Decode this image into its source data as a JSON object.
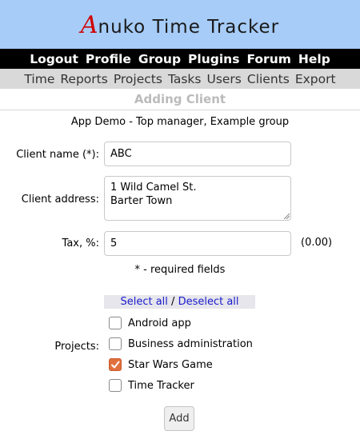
{
  "app": {
    "logo_initial": "A",
    "logo_rest": "nuko Time Tracker"
  },
  "top_menu": {
    "items": [
      "Logout",
      "Profile",
      "Group",
      "Plugins",
      "Forum",
      "Help"
    ]
  },
  "sub_menu": {
    "items": [
      "Time",
      "Reports",
      "Projects",
      "Tasks",
      "Users",
      "Clients",
      "Export"
    ]
  },
  "page": {
    "title": "Adding Client",
    "context": "App Demo - Top manager, Example group"
  },
  "form": {
    "client_name_label": "Client name (*):",
    "client_name_value": "ABC",
    "client_address_label": "Client address:",
    "client_address_value": "1 Wild Camel St.\nBarter Town",
    "tax_label": "Tax, %:",
    "tax_value": "5",
    "tax_calc": "(0.00)",
    "required_note": "* - required fields",
    "select_all": "Select all",
    "select_separator": " / ",
    "deselect_all": "Deselect all",
    "projects_label": "Projects:",
    "projects": [
      {
        "name": "Android app",
        "checked": false
      },
      {
        "name": "Business administration",
        "checked": false
      },
      {
        "name": "Star Wars Game",
        "checked": true
      },
      {
        "name": "Time Tracker",
        "checked": false
      }
    ],
    "add_button": "Add"
  },
  "colors": {
    "header_bg": "#a6ccf7",
    "logo_accent": "#d10000",
    "checkbox_checked": "#e0703d"
  }
}
